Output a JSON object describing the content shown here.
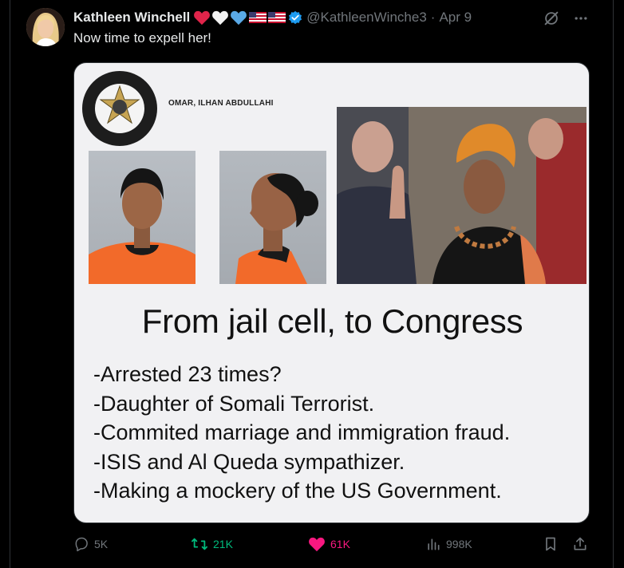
{
  "tweet": {
    "display_name": "Kathleen Winchell",
    "handle": "@KathleenWinche3",
    "separator": "·",
    "date": "Apr 9",
    "text": "Now time to expell her!",
    "emojis": [
      "red-heart",
      "white-heart",
      "blue-heart",
      "us-flag",
      "us-flag"
    ],
    "verified": true
  },
  "image": {
    "sheriff_caption": "OMAR, ILHAN ABDULLAHI",
    "headline": "From jail cell, to Congress",
    "bullets": [
      "-Arrested 23 times?",
      "-Daughter of Somali Terrorist.",
      "-Commited marriage and immigration fraud.",
      "-ISIS and Al Queda sympathizer.",
      "-Making a mockery of the US Government."
    ]
  },
  "actions": {
    "replies": "5K",
    "reposts": "21K",
    "likes": "61K",
    "views": "998K"
  },
  "colors": {
    "background": "#000000",
    "text": "#e7e9ea",
    "muted": "#71767b",
    "repost_green": "#00ba7c",
    "like_pink": "#f91880",
    "verified_blue": "#1d9bf0"
  }
}
